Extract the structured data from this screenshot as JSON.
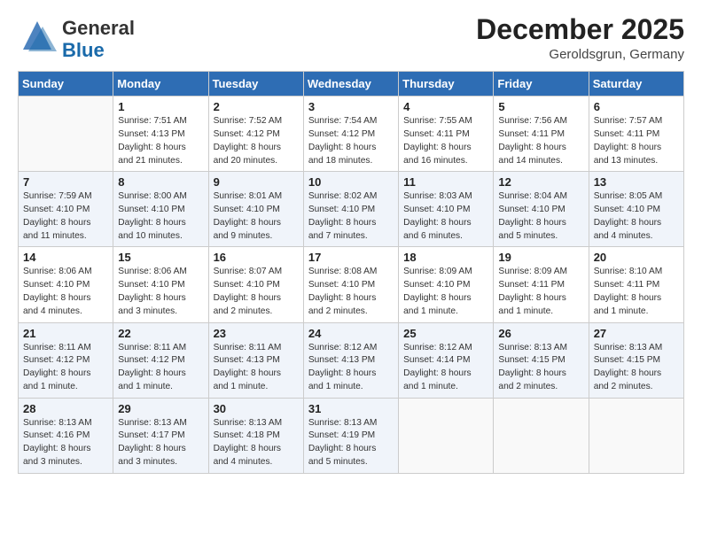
{
  "header": {
    "logo_general": "General",
    "logo_blue": "Blue",
    "month_year": "December 2025",
    "location": "Geroldsgrun, Germany"
  },
  "weekdays": [
    "Sunday",
    "Monday",
    "Tuesday",
    "Wednesday",
    "Thursday",
    "Friday",
    "Saturday"
  ],
  "weeks": [
    [
      {
        "day": "",
        "lines": []
      },
      {
        "day": "1",
        "lines": [
          "Sunrise: 7:51 AM",
          "Sunset: 4:13 PM",
          "Daylight: 8 hours",
          "and 21 minutes."
        ]
      },
      {
        "day": "2",
        "lines": [
          "Sunrise: 7:52 AM",
          "Sunset: 4:12 PM",
          "Daylight: 8 hours",
          "and 20 minutes."
        ]
      },
      {
        "day": "3",
        "lines": [
          "Sunrise: 7:54 AM",
          "Sunset: 4:12 PM",
          "Daylight: 8 hours",
          "and 18 minutes."
        ]
      },
      {
        "day": "4",
        "lines": [
          "Sunrise: 7:55 AM",
          "Sunset: 4:11 PM",
          "Daylight: 8 hours",
          "and 16 minutes."
        ]
      },
      {
        "day": "5",
        "lines": [
          "Sunrise: 7:56 AM",
          "Sunset: 4:11 PM",
          "Daylight: 8 hours",
          "and 14 minutes."
        ]
      },
      {
        "day": "6",
        "lines": [
          "Sunrise: 7:57 AM",
          "Sunset: 4:11 PM",
          "Daylight: 8 hours",
          "and 13 minutes."
        ]
      }
    ],
    [
      {
        "day": "7",
        "lines": [
          "Sunrise: 7:59 AM",
          "Sunset: 4:10 PM",
          "Daylight: 8 hours",
          "and 11 minutes."
        ]
      },
      {
        "day": "8",
        "lines": [
          "Sunrise: 8:00 AM",
          "Sunset: 4:10 PM",
          "Daylight: 8 hours",
          "and 10 minutes."
        ]
      },
      {
        "day": "9",
        "lines": [
          "Sunrise: 8:01 AM",
          "Sunset: 4:10 PM",
          "Daylight: 8 hours",
          "and 9 minutes."
        ]
      },
      {
        "day": "10",
        "lines": [
          "Sunrise: 8:02 AM",
          "Sunset: 4:10 PM",
          "Daylight: 8 hours",
          "and 7 minutes."
        ]
      },
      {
        "day": "11",
        "lines": [
          "Sunrise: 8:03 AM",
          "Sunset: 4:10 PM",
          "Daylight: 8 hours",
          "and 6 minutes."
        ]
      },
      {
        "day": "12",
        "lines": [
          "Sunrise: 8:04 AM",
          "Sunset: 4:10 PM",
          "Daylight: 8 hours",
          "and 5 minutes."
        ]
      },
      {
        "day": "13",
        "lines": [
          "Sunrise: 8:05 AM",
          "Sunset: 4:10 PM",
          "Daylight: 8 hours",
          "and 4 minutes."
        ]
      }
    ],
    [
      {
        "day": "14",
        "lines": [
          "Sunrise: 8:06 AM",
          "Sunset: 4:10 PM",
          "Daylight: 8 hours",
          "and 4 minutes."
        ]
      },
      {
        "day": "15",
        "lines": [
          "Sunrise: 8:06 AM",
          "Sunset: 4:10 PM",
          "Daylight: 8 hours",
          "and 3 minutes."
        ]
      },
      {
        "day": "16",
        "lines": [
          "Sunrise: 8:07 AM",
          "Sunset: 4:10 PM",
          "Daylight: 8 hours",
          "and 2 minutes."
        ]
      },
      {
        "day": "17",
        "lines": [
          "Sunrise: 8:08 AM",
          "Sunset: 4:10 PM",
          "Daylight: 8 hours",
          "and 2 minutes."
        ]
      },
      {
        "day": "18",
        "lines": [
          "Sunrise: 8:09 AM",
          "Sunset: 4:10 PM",
          "Daylight: 8 hours",
          "and 1 minute."
        ]
      },
      {
        "day": "19",
        "lines": [
          "Sunrise: 8:09 AM",
          "Sunset: 4:11 PM",
          "Daylight: 8 hours",
          "and 1 minute."
        ]
      },
      {
        "day": "20",
        "lines": [
          "Sunrise: 8:10 AM",
          "Sunset: 4:11 PM",
          "Daylight: 8 hours",
          "and 1 minute."
        ]
      }
    ],
    [
      {
        "day": "21",
        "lines": [
          "Sunrise: 8:11 AM",
          "Sunset: 4:12 PM",
          "Daylight: 8 hours",
          "and 1 minute."
        ]
      },
      {
        "day": "22",
        "lines": [
          "Sunrise: 8:11 AM",
          "Sunset: 4:12 PM",
          "Daylight: 8 hours",
          "and 1 minute."
        ]
      },
      {
        "day": "23",
        "lines": [
          "Sunrise: 8:11 AM",
          "Sunset: 4:13 PM",
          "Daylight: 8 hours",
          "and 1 minute."
        ]
      },
      {
        "day": "24",
        "lines": [
          "Sunrise: 8:12 AM",
          "Sunset: 4:13 PM",
          "Daylight: 8 hours",
          "and 1 minute."
        ]
      },
      {
        "day": "25",
        "lines": [
          "Sunrise: 8:12 AM",
          "Sunset: 4:14 PM",
          "Daylight: 8 hours",
          "and 1 minute."
        ]
      },
      {
        "day": "26",
        "lines": [
          "Sunrise: 8:13 AM",
          "Sunset: 4:15 PM",
          "Daylight: 8 hours",
          "and 2 minutes."
        ]
      },
      {
        "day": "27",
        "lines": [
          "Sunrise: 8:13 AM",
          "Sunset: 4:15 PM",
          "Daylight: 8 hours",
          "and 2 minutes."
        ]
      }
    ],
    [
      {
        "day": "28",
        "lines": [
          "Sunrise: 8:13 AM",
          "Sunset: 4:16 PM",
          "Daylight: 8 hours",
          "and 3 minutes."
        ]
      },
      {
        "day": "29",
        "lines": [
          "Sunrise: 8:13 AM",
          "Sunset: 4:17 PM",
          "Daylight: 8 hours",
          "and 3 minutes."
        ]
      },
      {
        "day": "30",
        "lines": [
          "Sunrise: 8:13 AM",
          "Sunset: 4:18 PM",
          "Daylight: 8 hours",
          "and 4 minutes."
        ]
      },
      {
        "day": "31",
        "lines": [
          "Sunrise: 8:13 AM",
          "Sunset: 4:19 PM",
          "Daylight: 8 hours",
          "and 5 minutes."
        ]
      },
      {
        "day": "",
        "lines": []
      },
      {
        "day": "",
        "lines": []
      },
      {
        "day": "",
        "lines": []
      }
    ]
  ]
}
